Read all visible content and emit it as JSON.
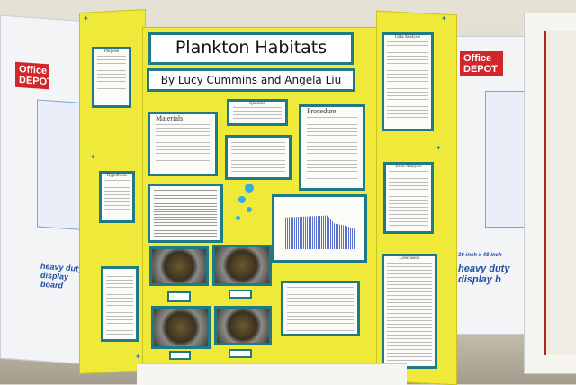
{
  "board": {
    "title": "Plankton Habitats",
    "authors": "By Lucy Cummins and Angela Liu"
  },
  "sections": {
    "purpose": "Purpose",
    "hypothesis": "Hypothesis",
    "materials": "Materials",
    "question": "Question",
    "procedure": "Procedure",
    "data_analysis": "Data Analysis",
    "error_analysis": "Error Analysis",
    "conclusion": "Conclusion"
  },
  "side_boards": {
    "brand": "Office DEPOT",
    "product_left": "heavy duty display board",
    "product_right_size": "36-inch x 48-inch",
    "product_right": "heavy duty display b"
  },
  "colors": {
    "board_yellow": "#efe93a",
    "card_border": "#1f7a85",
    "brand_red": "#d1262b",
    "brand_blue": "#1f4fa3"
  }
}
